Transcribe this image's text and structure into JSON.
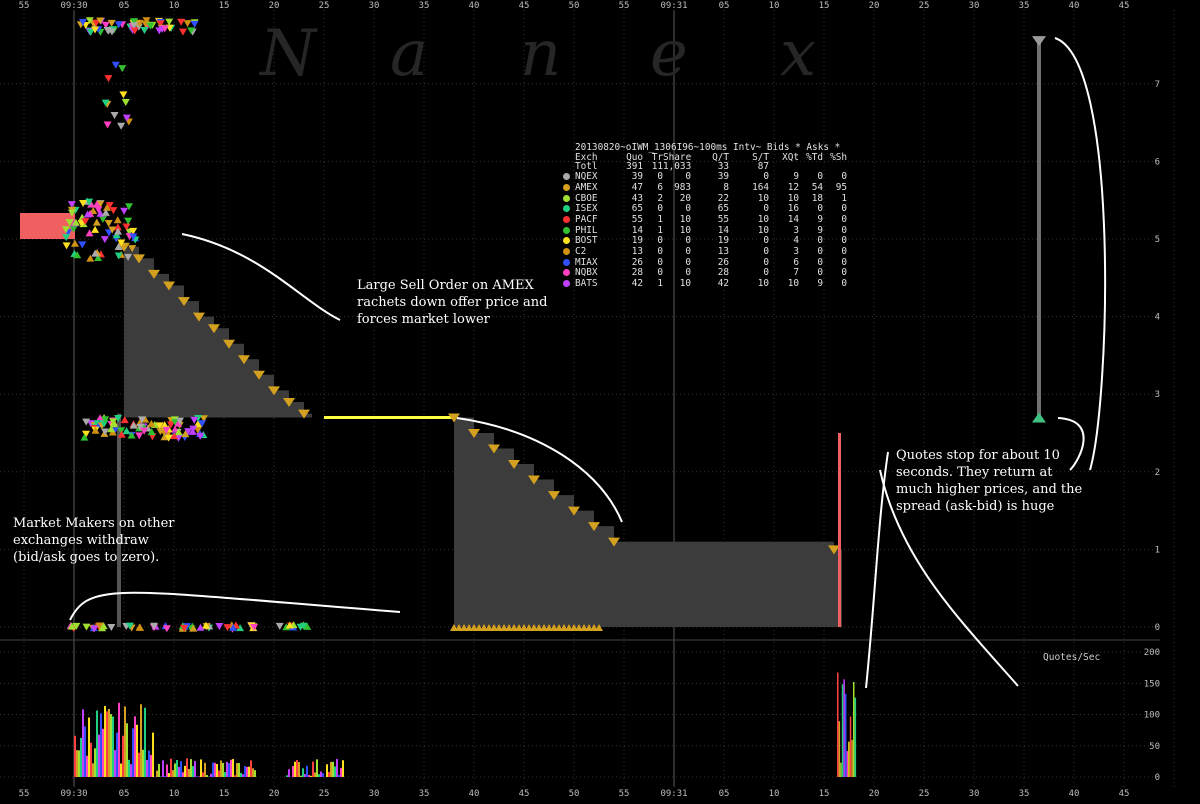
{
  "watermark": [
    "N",
    "a",
    "n",
    "e",
    "x"
  ],
  "chart_data": {
    "type": "line",
    "title": "20130820~oIWM_1306I96~100ms Intv~ Bids * Asks *",
    "x_ticks_top": [
      "55",
      "09:30",
      "05",
      "10",
      "15",
      "20",
      "25",
      "30",
      "35",
      "40",
      "45",
      "50",
      "55",
      "09:31",
      "05",
      "10",
      "15",
      "20",
      "25",
      "30",
      "35",
      "40",
      "45"
    ],
    "x_ticks_bottom": [
      "55",
      "09:30",
      "05",
      "10",
      "15",
      "20",
      "25",
      "30",
      "35",
      "40",
      "45",
      "50",
      "55",
      "09:31",
      "05",
      "10",
      "15",
      "20",
      "25",
      "30",
      "35",
      "40",
      "45"
    ],
    "price_axis": {
      "ticks": [
        0,
        1,
        2,
        3,
        4,
        5,
        6,
        7
      ],
      "ylim": [
        0,
        7.5
      ]
    },
    "rate_axis": {
      "label": "Quotes/Sec",
      "ticks": [
        0,
        50,
        100,
        150,
        200
      ],
      "ylim": [
        0,
        200
      ]
    },
    "amex_offer_steps": [
      {
        "t": 5.0,
        "price": 4.9
      },
      {
        "t": 6.5,
        "price": 4.75
      },
      {
        "t": 8.0,
        "price": 4.55
      },
      {
        "t": 9.5,
        "price": 4.4
      },
      {
        "t": 11.0,
        "price": 4.2
      },
      {
        "t": 12.5,
        "price": 4.0
      },
      {
        "t": 14.0,
        "price": 3.85
      },
      {
        "t": 15.5,
        "price": 3.65
      },
      {
        "t": 17.0,
        "price": 3.45
      },
      {
        "t": 18.5,
        "price": 3.25
      },
      {
        "t": 20.0,
        "price": 3.05
      },
      {
        "t": 21.5,
        "price": 2.9
      },
      {
        "t": 23.0,
        "price": 2.75
      },
      {
        "t": 38.0,
        "price": 2.7
      },
      {
        "t": 40.0,
        "price": 2.5
      },
      {
        "t": 42.0,
        "price": 2.3
      },
      {
        "t": 44.0,
        "price": 2.1
      },
      {
        "t": 46.0,
        "price": 1.9
      },
      {
        "t": 48.0,
        "price": 1.7
      },
      {
        "t": 50.0,
        "price": 1.5
      },
      {
        "t": 52.0,
        "price": 1.3
      },
      {
        "t": 54.0,
        "price": 1.1
      },
      {
        "t": 76.0,
        "price": 1.0
      }
    ],
    "bid_level": 2.7,
    "late_quote": {
      "t": 96.5,
      "bid": 2.7,
      "ask": 7.55
    },
    "stats_table": {
      "columns": [
        "Exch",
        "Quo",
        "Tr",
        "Share",
        "Q/T",
        "S/T",
        "XQt",
        "%Td",
        "%Sh"
      ],
      "rows": [
        {
          "name": "Totl",
          "cells": [
            "391",
            "11",
            "1,033",
            "33",
            "87",
            "",
            "",
            ""
          ],
          "color": ""
        },
        {
          "name": "NQEX",
          "cells": [
            "39",
            "0",
            "0",
            "39",
            "0",
            "9",
            "0",
            "0"
          ],
          "color": "#aaaaaa"
        },
        {
          "name": "AMEX",
          "cells": [
            "47",
            "6",
            "983",
            "8",
            "164",
            "12",
            "54",
            "95"
          ],
          "color": "#d4a020"
        },
        {
          "name": "CBOE",
          "cells": [
            "43",
            "2",
            "20",
            "22",
            "10",
            "10",
            "18",
            "1"
          ],
          "color": "#a0e030"
        },
        {
          "name": "ISEX",
          "cells": [
            "65",
            "0",
            "0",
            "65",
            "0",
            "16",
            "0",
            "0"
          ],
          "color": "#20d080"
        },
        {
          "name": "PACF",
          "cells": [
            "55",
            "1",
            "10",
            "55",
            "10",
            "14",
            "9",
            "0"
          ],
          "color": "#ff3030"
        },
        {
          "name": "PHIL",
          "cells": [
            "14",
            "1",
            "10",
            "14",
            "10",
            "3",
            "9",
            "0"
          ],
          "color": "#30c030"
        },
        {
          "name": "BOST",
          "cells": [
            "19",
            "0",
            "0",
            "19",
            "0",
            "4",
            "0",
            "0"
          ],
          "color": "#ffe020"
        },
        {
          "name": "C2",
          "cells": [
            "13",
            "0",
            "0",
            "13",
            "0",
            "3",
            "0",
            "0"
          ],
          "color": "#d09010"
        },
        {
          "name": "MIAX",
          "cells": [
            "26",
            "0",
            "0",
            "26",
            "0",
            "6",
            "0",
            "0"
          ],
          "color": "#3050ff"
        },
        {
          "name": "NQBX",
          "cells": [
            "28",
            "0",
            "0",
            "28",
            "0",
            "7",
            "0",
            "0"
          ],
          "color": "#ff40c0"
        },
        {
          "name": "BATS",
          "cells": [
            "42",
            "1",
            "10",
            "42",
            "10",
            "10",
            "9",
            "0"
          ],
          "color": "#c040ff"
        }
      ]
    }
  },
  "annotations": {
    "sell_order": "Large Sell Order on AMEX\nrachets down offer price and\nforces market lower",
    "market_makers": "Market Makers on other\nexchanges withdraw\n(bid/ask goes to zero).",
    "quotes_stop": "Quotes stop for about 10\nseconds. They return at\nmuch higher prices, and the\nspread (ask-bid) is huge"
  },
  "colors": {
    "background": "#000000",
    "grid": "#333333",
    "amex": "#d4a020",
    "fill_area": "#3c3c3c",
    "bid_line": "#ffff40",
    "pink_bar": "#f06060",
    "annotation": "#ffffff"
  }
}
